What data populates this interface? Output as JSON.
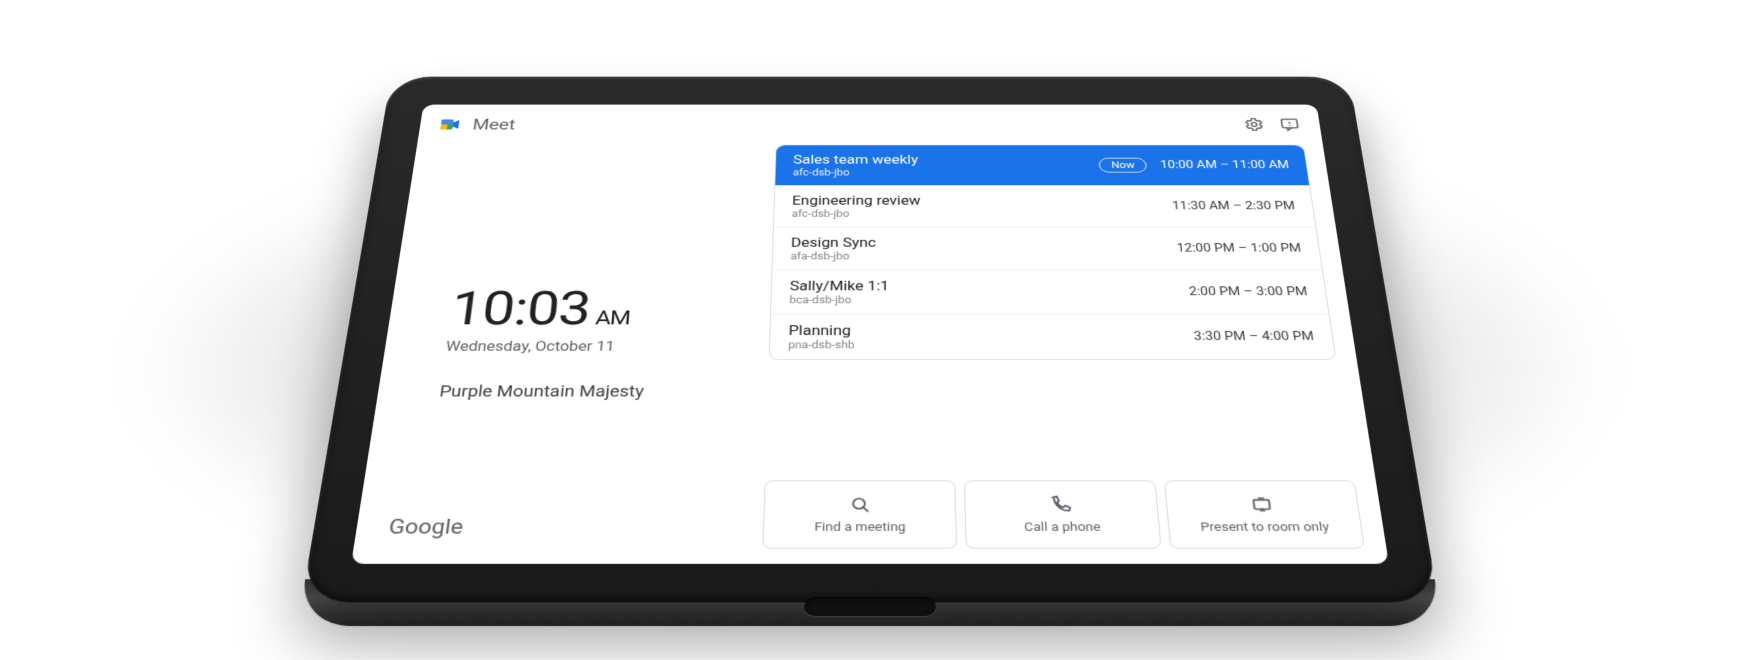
{
  "header": {
    "app_name": "Meet"
  },
  "clock": {
    "time": "10:03",
    "ampm": "AM",
    "date": "Wednesday, October 11"
  },
  "room_name": "Purple Mountain Majesty",
  "footer_brand": "Google",
  "agenda": [
    {
      "title": "Sales team weekly",
      "code": "afc-dsb-jbo",
      "time_range": "10:00 AM – 11:00 AM",
      "now": true,
      "now_label": "Now"
    },
    {
      "title": "Engineering review",
      "code": "afc-dsb-jbo",
      "time_range": "11:30 AM – 2:30 PM",
      "now": false
    },
    {
      "title": "Design Sync",
      "code": "afa-dsb-jbo",
      "time_range": "12:00 PM – 1:00 PM",
      "now": false
    },
    {
      "title": "Sally/Mike 1:1",
      "code": "bca-dsb-jbo",
      "time_range": "2:00 PM – 3:00 PM",
      "now": false
    },
    {
      "title": "Planning",
      "code": "pna-dsb-shb",
      "time_range": "3:30 PM – 4:00 PM",
      "now": false
    }
  ],
  "actions": {
    "find_meeting": "Find a meeting",
    "call_phone": "Call a phone",
    "present_room": "Present to room only"
  }
}
